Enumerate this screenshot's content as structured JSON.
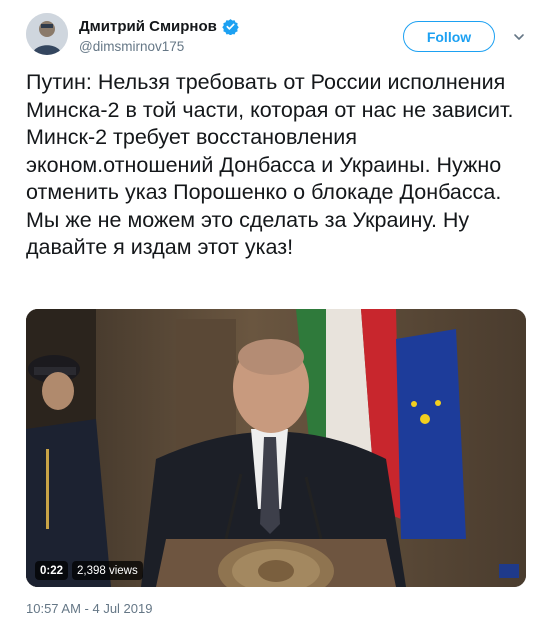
{
  "user": {
    "display_name": "Дмитрий Смирнов",
    "handle": "@dimsmirnov175",
    "verified": true,
    "avatar_icon": "profile-avatar"
  },
  "actions": {
    "follow_label": "Follow",
    "menu_icon": "chevron-down-icon"
  },
  "tweet": {
    "text": "Путин: Нельзя требовать от России исполнения Минска-2 в той части, которая от нас не зависит. Минск-2 требует восстановления эконом.отношений Донбасса и Украины. Нужно отменить указ Порошенко о блокаде Донбасса. Мы же не можем это сделать за Украину. Ну давайте я издам этот указ!",
    "timestamp": "10:57 AM - 4 Jul 2019"
  },
  "media": {
    "type": "video",
    "duration": "0:22",
    "views": "2,398 views"
  },
  "colors": {
    "accent": "#1da1f2",
    "text": "#14171a",
    "secondary": "#657786"
  }
}
